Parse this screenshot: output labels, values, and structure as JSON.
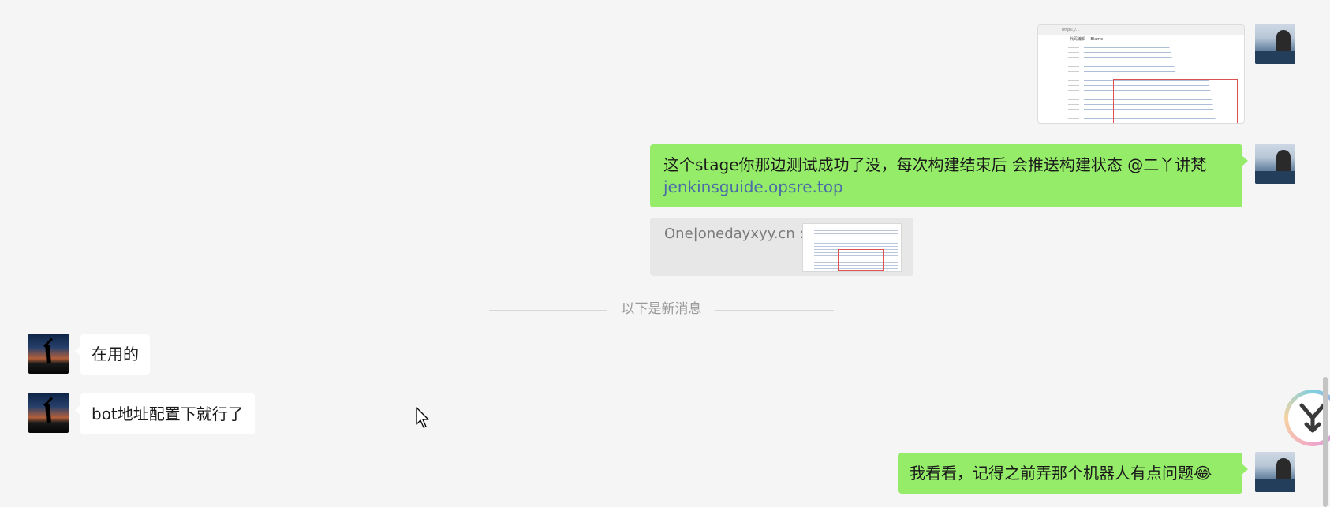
{
  "messages": {
    "m1_sender": "me",
    "m2_text": "这个stage你那边测试成功了没，每次构建结束后 会推送构建状态 @二丫讲梵",
    "m2_link": "jenkinsguide.opsre.top",
    "m3_quote_text": "One|onedayxyy.cn :",
    "divider_label": "以下是新消息",
    "m4_text": "在用的",
    "m5_text": "bot地址配置下就行了",
    "m6_text": "我看看，记得之前弄那个机器人有点问题😂"
  },
  "screenshot_thumb": {
    "tab1": "代码编辑",
    "tab2": "Blame"
  },
  "colors": {
    "background": "#f5f5f5",
    "my_bubble": "#95ec69",
    "other_bubble": "#ffffff",
    "link": "#4a6aa8",
    "quote_bg": "#e7e7e7"
  },
  "icons": {
    "float_app": "app-logo-icon",
    "cursor": "mouse-pointer-icon"
  }
}
